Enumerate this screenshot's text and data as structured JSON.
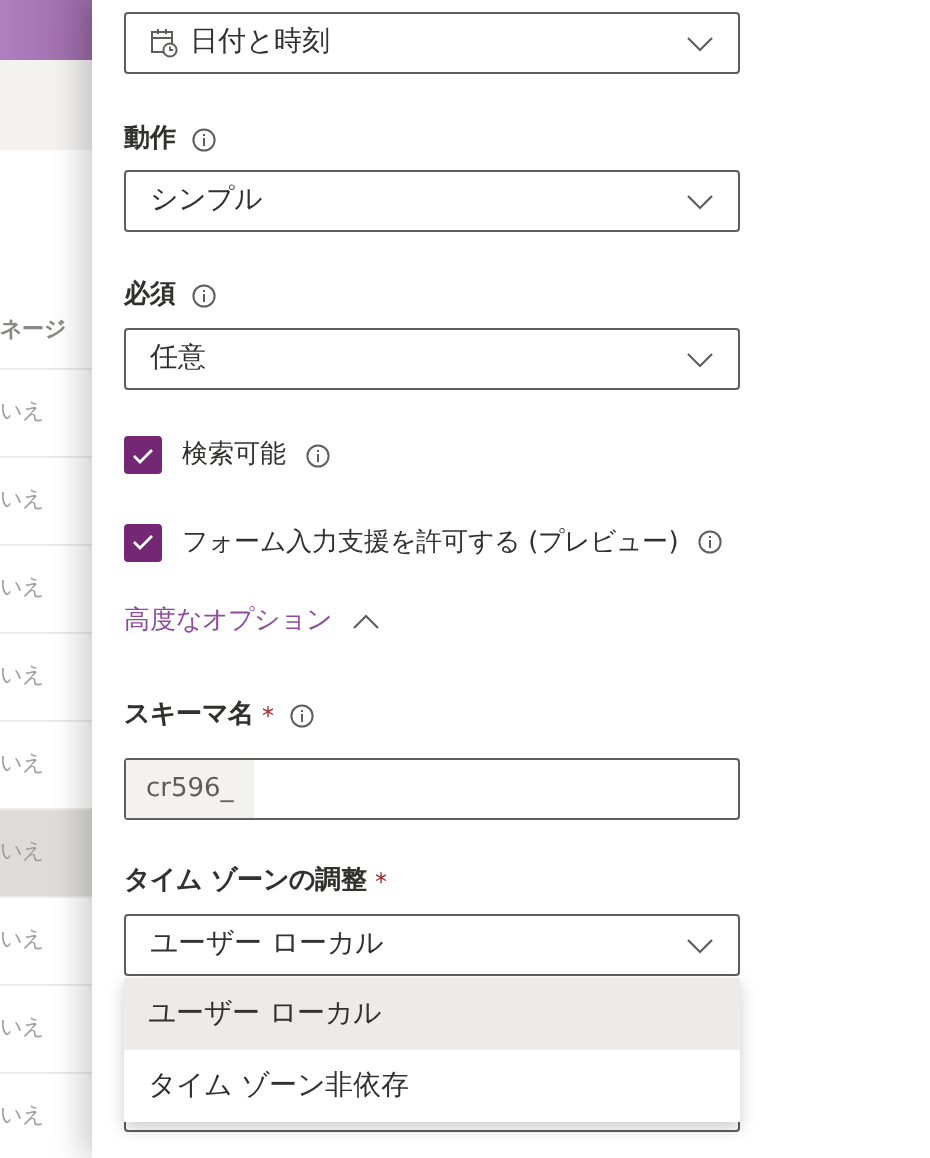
{
  "background": {
    "column_header": "ネージ",
    "rows": [
      {
        "cell": "いえ",
        "selected": false
      },
      {
        "cell": "いえ",
        "selected": false
      },
      {
        "cell": "いえ",
        "selected": false
      },
      {
        "cell": "いえ",
        "selected": false
      },
      {
        "cell": "いえ",
        "selected": false
      },
      {
        "cell": "いえ",
        "selected": true
      },
      {
        "cell": "いえ",
        "selected": false
      },
      {
        "cell": "いえ",
        "selected": false
      },
      {
        "cell": "いえ",
        "selected": false
      }
    ]
  },
  "panel": {
    "data_type": {
      "value": "日付と時刻"
    },
    "behavior": {
      "label": "動作",
      "value": "シンプル"
    },
    "required": {
      "label": "必須",
      "value": "任意"
    },
    "checkboxes": [
      {
        "label": "検索可能",
        "checked": true
      },
      {
        "label": "フォーム入力支援を許可する (プレビュー)",
        "checked": true
      }
    ],
    "advanced_options": {
      "label": "高度なオプション",
      "expanded": true
    },
    "schema_name": {
      "label": "スキーマ名",
      "required": true,
      "required_mark": "*",
      "prefix": "cr596_"
    },
    "time_zone": {
      "label": "タイム ゾーンの調整",
      "required": true,
      "required_mark": "*",
      "value": "ユーザー ローカル",
      "options": [
        {
          "label": "ユーザー ローカル",
          "selected": true
        },
        {
          "label": "タイム ゾーン非依存",
          "selected": false
        }
      ]
    }
  }
}
